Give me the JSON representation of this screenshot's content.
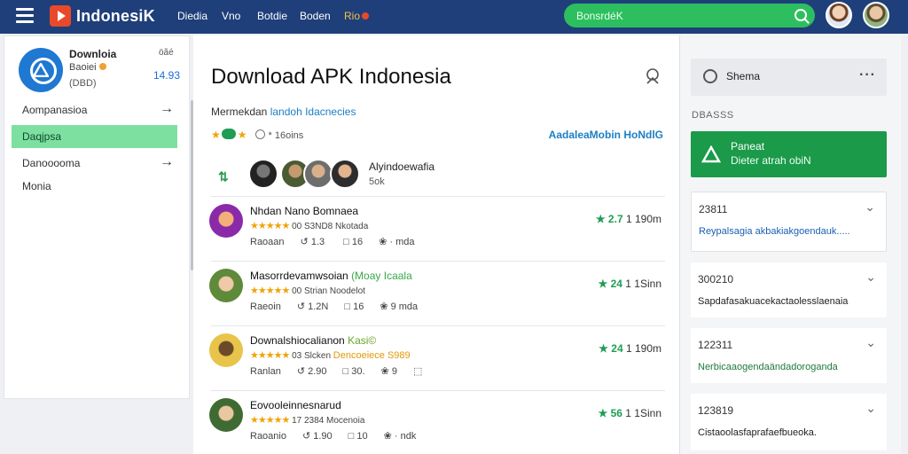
{
  "header": {
    "brand": "IndonesiK",
    "nav": [
      "Diedia",
      "Vno",
      "Botdie",
      "Boden",
      "Rio"
    ],
    "search_text": "BonsrdéK"
  },
  "sidebar": {
    "app_title": "Downloia",
    "app_sub": "Baoiei",
    "app_code": "(DBD)",
    "app_meta1": "öãé",
    "app_meta2": "14.93",
    "items": [
      {
        "label": "Aompanasioa",
        "arrow": "→"
      },
      {
        "label": "Daqjpsa",
        "arrow": ""
      },
      {
        "label": "Danooooma",
        "arrow": "→"
      },
      {
        "label": "Monia",
        "arrow": ""
      }
    ]
  },
  "main": {
    "title": "Download APK Indonesia",
    "subtitle_prefix": "Mermekdan",
    "subtitle_highlight": "landoh Idacnecies",
    "rating_text": "* 16oins",
    "tag_link": "AadaleaMobin HoNdlG",
    "developer": {
      "name": "Alyindoewafia",
      "count": "5ok"
    },
    "apps": [
      {
        "title": "Nhdan Nano Bomnaea",
        "title_alt": "",
        "meta": "00 S3ND8 Nkotada",
        "meta_orange": "",
        "foot": [
          "Raoaan",
          "↺ 1.3 ",
          "□ 16",
          "❀ · mda"
        ],
        "score": "★ 2.7",
        "score_grey": "1 190m"
      },
      {
        "title": "Masorrdevamwsoian",
        "title_alt": "(Moay Icaala",
        "meta": "00 Strian Noodelot",
        "meta_orange": "",
        "foot": [
          "Raeoin",
          "↺ 1.2N",
          "□ 16",
          "❀ 9 mda"
        ],
        "score": "★ 24",
        "score_grey": "1 1Sinn"
      },
      {
        "title": "Downalshiocalianon",
        "title_alt": "Kasi©",
        "meta": "03 Slcken",
        "meta_orange": "Dencoeiece S989",
        "foot": [
          "Ranlan",
          "↺ 2.90",
          "□ 30.",
          "❀ 9",
          "⬚"
        ],
        "score": "★ 24",
        "score_grey": "1 190m"
      },
      {
        "title": "Eovooleinnesnarud",
        "title_alt": "",
        "meta": "17 2384 Mocenoia",
        "meta_orange": "",
        "foot": [
          "Raoanio",
          "↺ 1.90",
          "□ 10",
          "❀ · ndk"
        ],
        "score": "★ 56",
        "score_grey": "1 1Sinn"
      }
    ]
  },
  "right": {
    "share_label": "Shema",
    "section_label": "DBASSS",
    "green_title": "Paneat",
    "green_sub": "Dieter atrah obiN",
    "accordions": [
      {
        "head": "23811",
        "body": "Reypalsagia akbakiakgoendauk.....",
        "style": "blue"
      },
      {
        "head": "300210",
        "body": "Sapdafasakuacekactaolesslaenaia",
        "style": "dark"
      },
      {
        "head": "122311",
        "body": "Nerbicaaogendaändadoroganda",
        "style": "green"
      },
      {
        "head": "123819",
        "body": "Cistaoolasfaprafaefbueoka.",
        "style": "dark"
      }
    ]
  }
}
